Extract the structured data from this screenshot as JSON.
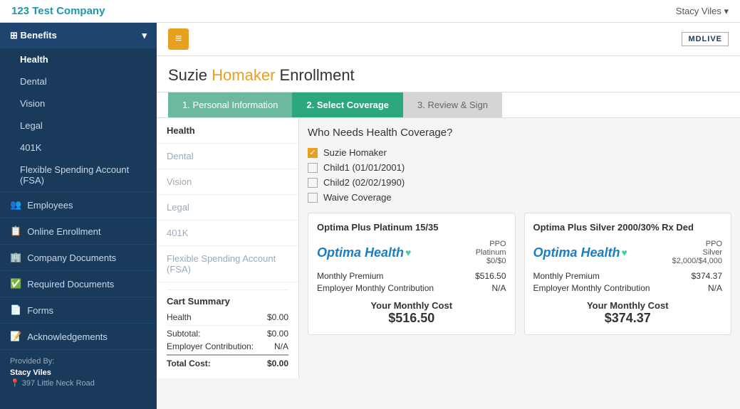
{
  "topbar": {
    "company_name": "123 Test Company",
    "user_name": "Stacy Viles ▾",
    "mdlive": "MDLIVE"
  },
  "sidebar": {
    "benefits_label": "Benefits",
    "nav_items": [
      {
        "label": "Health",
        "active": true
      },
      {
        "label": "Dental",
        "active": false
      },
      {
        "label": "Vision",
        "active": false
      },
      {
        "label": "Legal",
        "active": false
      },
      {
        "label": "401K",
        "active": false
      },
      {
        "label": "Flexible Spending Account (FSA)",
        "active": false
      }
    ],
    "main_items": [
      {
        "label": "Employees",
        "icon": "👥"
      },
      {
        "label": "Online Enrollment",
        "icon": "📋"
      },
      {
        "label": "Company Documents",
        "icon": "🏢"
      },
      {
        "label": "Required Documents",
        "icon": "✅"
      },
      {
        "label": "Forms",
        "icon": "📄"
      },
      {
        "label": "Acknowledgements",
        "icon": "📝"
      }
    ],
    "provided_by": "Provided By:",
    "agent_name": "Stacy Viles",
    "address": "397 Little Neck Road"
  },
  "header": {
    "hamburger_icon": "≡"
  },
  "page_title_part1": "Suzie ",
  "page_title_part2": "Homaker ",
  "page_title_part3": "Enrollment",
  "steps": [
    {
      "label": "1. Personal Information",
      "state": "completed"
    },
    {
      "label": "2. Select Coverage",
      "state": "active"
    },
    {
      "label": "3. Review & Sign",
      "state": "inactive"
    }
  ],
  "left_panel": {
    "items": [
      {
        "label": "Health",
        "active": true
      },
      {
        "label": "Dental",
        "active": false
      },
      {
        "label": "Vision",
        "active": false
      },
      {
        "label": "Legal",
        "active": false
      },
      {
        "label": "401K",
        "active": false
      },
      {
        "label": "Flexible Spending Account (FSA)",
        "active": false
      }
    ],
    "cart": {
      "title": "Cart Summary",
      "rows": [
        {
          "label": "Health",
          "value": "$0.00"
        },
        {
          "label": "Subtotal:",
          "value": "$0.00"
        },
        {
          "label": "Employer Contribution:",
          "value": "N/A"
        },
        {
          "label": "Total Cost:",
          "value": "$0.00"
        }
      ]
    }
  },
  "coverage": {
    "question": "Who Needs Health Coverage?",
    "checkboxes": [
      {
        "label": "Suzie Homaker",
        "checked": true
      },
      {
        "label": "Child1 (01/01/2001)",
        "checked": false
      },
      {
        "label": "Child2 (02/02/1990)",
        "checked": false
      },
      {
        "label": "Waive Coverage",
        "checked": false
      }
    ]
  },
  "plans": [
    {
      "title": "Optima Plus Platinum 15/35",
      "logo": "Optima Health",
      "type_line1": "PPO",
      "type_line2": "Platinum",
      "type_line3": "$0/$0",
      "monthly_premium_label": "Monthly Premium",
      "monthly_premium_value": "$516.50",
      "employer_monthly_label": "Employer Monthly Contribution",
      "employer_monthly_value": "N/A",
      "your_cost_label": "Your Monthly Cost",
      "your_cost_value": "$516.50"
    },
    {
      "title": "Optima Plus Silver 2000/30% Rx Ded",
      "logo": "Optima Health",
      "type_line1": "PPO",
      "type_line2": "Silver",
      "type_line3": "$2,000/$4,000",
      "monthly_premium_label": "Monthly Premium",
      "monthly_premium_value": "$374.37",
      "employer_monthly_label": "Employer Monthly Contribution",
      "employer_monthly_value": "N/A",
      "your_cost_label": "Your Monthly Cost",
      "your_cost_value": "$374.37"
    }
  ]
}
